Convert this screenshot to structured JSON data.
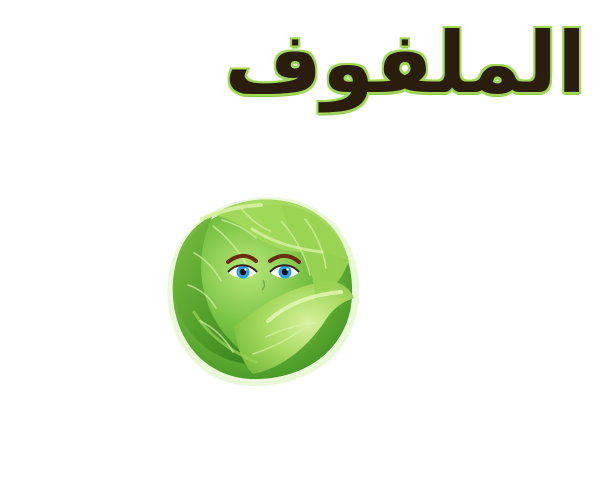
{
  "title": "الملفوف",
  "illustration": {
    "subject": "cabbage-with-face",
    "colors": {
      "outline": "#e9f7d8",
      "dark_leaf": "#3f9a22",
      "mid_leaf": "#66bb35",
      "light_leaf": "#a8df62",
      "highlight": "#d9f1a5",
      "eye_iris": "#2f9fe8",
      "brow": "#6b2b10"
    }
  }
}
